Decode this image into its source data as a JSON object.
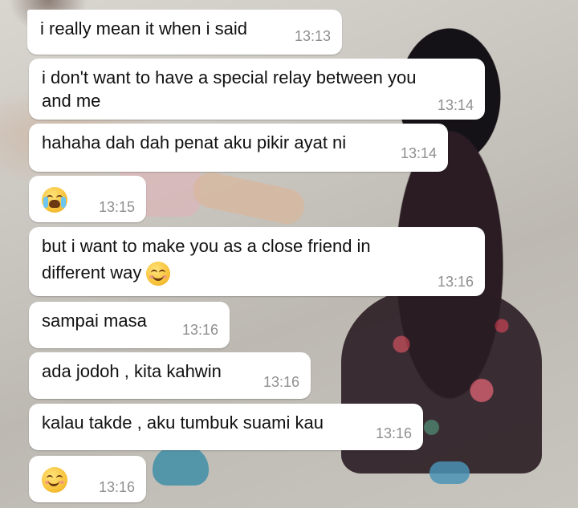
{
  "messages": [
    {
      "text": "i really mean it when i said",
      "time": "13:13"
    },
    {
      "text": "i don't want to have a special relay between you",
      "text2": "and me",
      "time": "13:14"
    },
    {
      "text": "hahaha dah dah penat aku pikir ayat ni",
      "time": "13:14"
    },
    {
      "emoji": "loudly-crying-face-emoji",
      "time": "13:15"
    },
    {
      "text": "but i want to make you as a close friend in",
      "text2": "different way",
      "emoji": "smiling-face-emoji",
      "time": "13:16"
    },
    {
      "text": "sampai masa",
      "time": "13:16"
    },
    {
      "text": "ada jodoh , kita kahwin",
      "time": "13:16"
    },
    {
      "text": "kalau takde , aku tumbuk suami kau",
      "time": "13:16"
    },
    {
      "emoji": "relieved-smiling-face-emoji",
      "time": "13:16"
    }
  ]
}
